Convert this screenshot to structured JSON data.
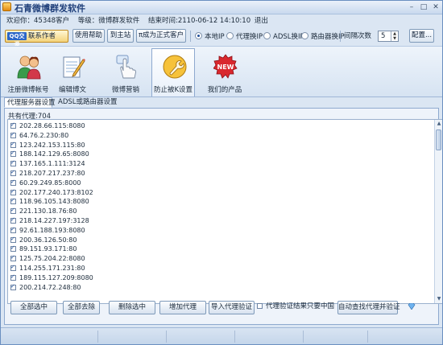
{
  "app": {
    "title": "石青微博群发软件",
    "window_buttons": [
      "–",
      "□",
      "✕"
    ]
  },
  "status_line": {
    "welcome": "欢迎你：45348客户",
    "level": "等级：微博群发软件",
    "expire": "结束时间:2110-06-12 14:10:10",
    "logout": "退出"
  },
  "toolbar": {
    "qq_badge": "QQ交谈",
    "qq_label": "联系作者",
    "help": "使用帮助",
    "site": "到主站",
    "upgrade": "π成为正式客户",
    "radios": [
      {
        "label": "本地IP",
        "selected": true
      },
      {
        "label": "代理换IP",
        "selected": false
      },
      {
        "label": "ADSL换IP",
        "selected": false
      },
      {
        "label": "路由器换IP",
        "selected": false
      }
    ],
    "interval_label": "间隔次数",
    "interval_value": "5",
    "config": "配置..."
  },
  "ribbon": {
    "items": [
      {
        "label": "注册微博帐号",
        "icon": "users-icon"
      },
      {
        "label": "编辑博文",
        "icon": "edit-notepad-icon"
      },
      {
        "label": "微博营销",
        "icon": "pointer-hand-icon"
      },
      {
        "label": "防止被K设置",
        "icon": "wrench-icon",
        "active": true
      },
      {
        "label": "我们的产品",
        "icon": "new-badge-icon"
      }
    ]
  },
  "tabs": [
    {
      "label": "代理服务器设置",
      "active": true
    },
    {
      "label": "ADSL或路由器设置",
      "active": false
    }
  ],
  "proxy": {
    "count_label": "共有代理:704",
    "items": [
      "202.28.66.115:8080",
      "64.76.2.230:80",
      "123.242.153.115:80",
      "188.142.129.65:8080",
      "137.165.1.111:3124",
      "218.207.217.237:80",
      "60.29.249.85:8000",
      "202.177.240.173:8102",
      "118.96.105.143:8080",
      "221.130.18.76:80",
      "218.14.227.197:3128",
      "92.61.188.193:8080",
      "200.36.126.50:80",
      "89.151.93.171:80",
      "125.75.204.22:8080",
      "114.255.171.231:80",
      "189.115.127.209:8080",
      "200.214.72.248:80"
    ]
  },
  "actions": {
    "select_all": "全部选中",
    "remove_all": "全部去除",
    "delete_selected": "删除选中",
    "add_proxy": "增加代理",
    "import_verify": "导入代理验证",
    "only_china": "代理验证结果只要中国",
    "auto_find": "自动查找代理并验证"
  },
  "colors": {
    "accent": "#1f4f9a",
    "window_border": "#6a8fc0"
  }
}
